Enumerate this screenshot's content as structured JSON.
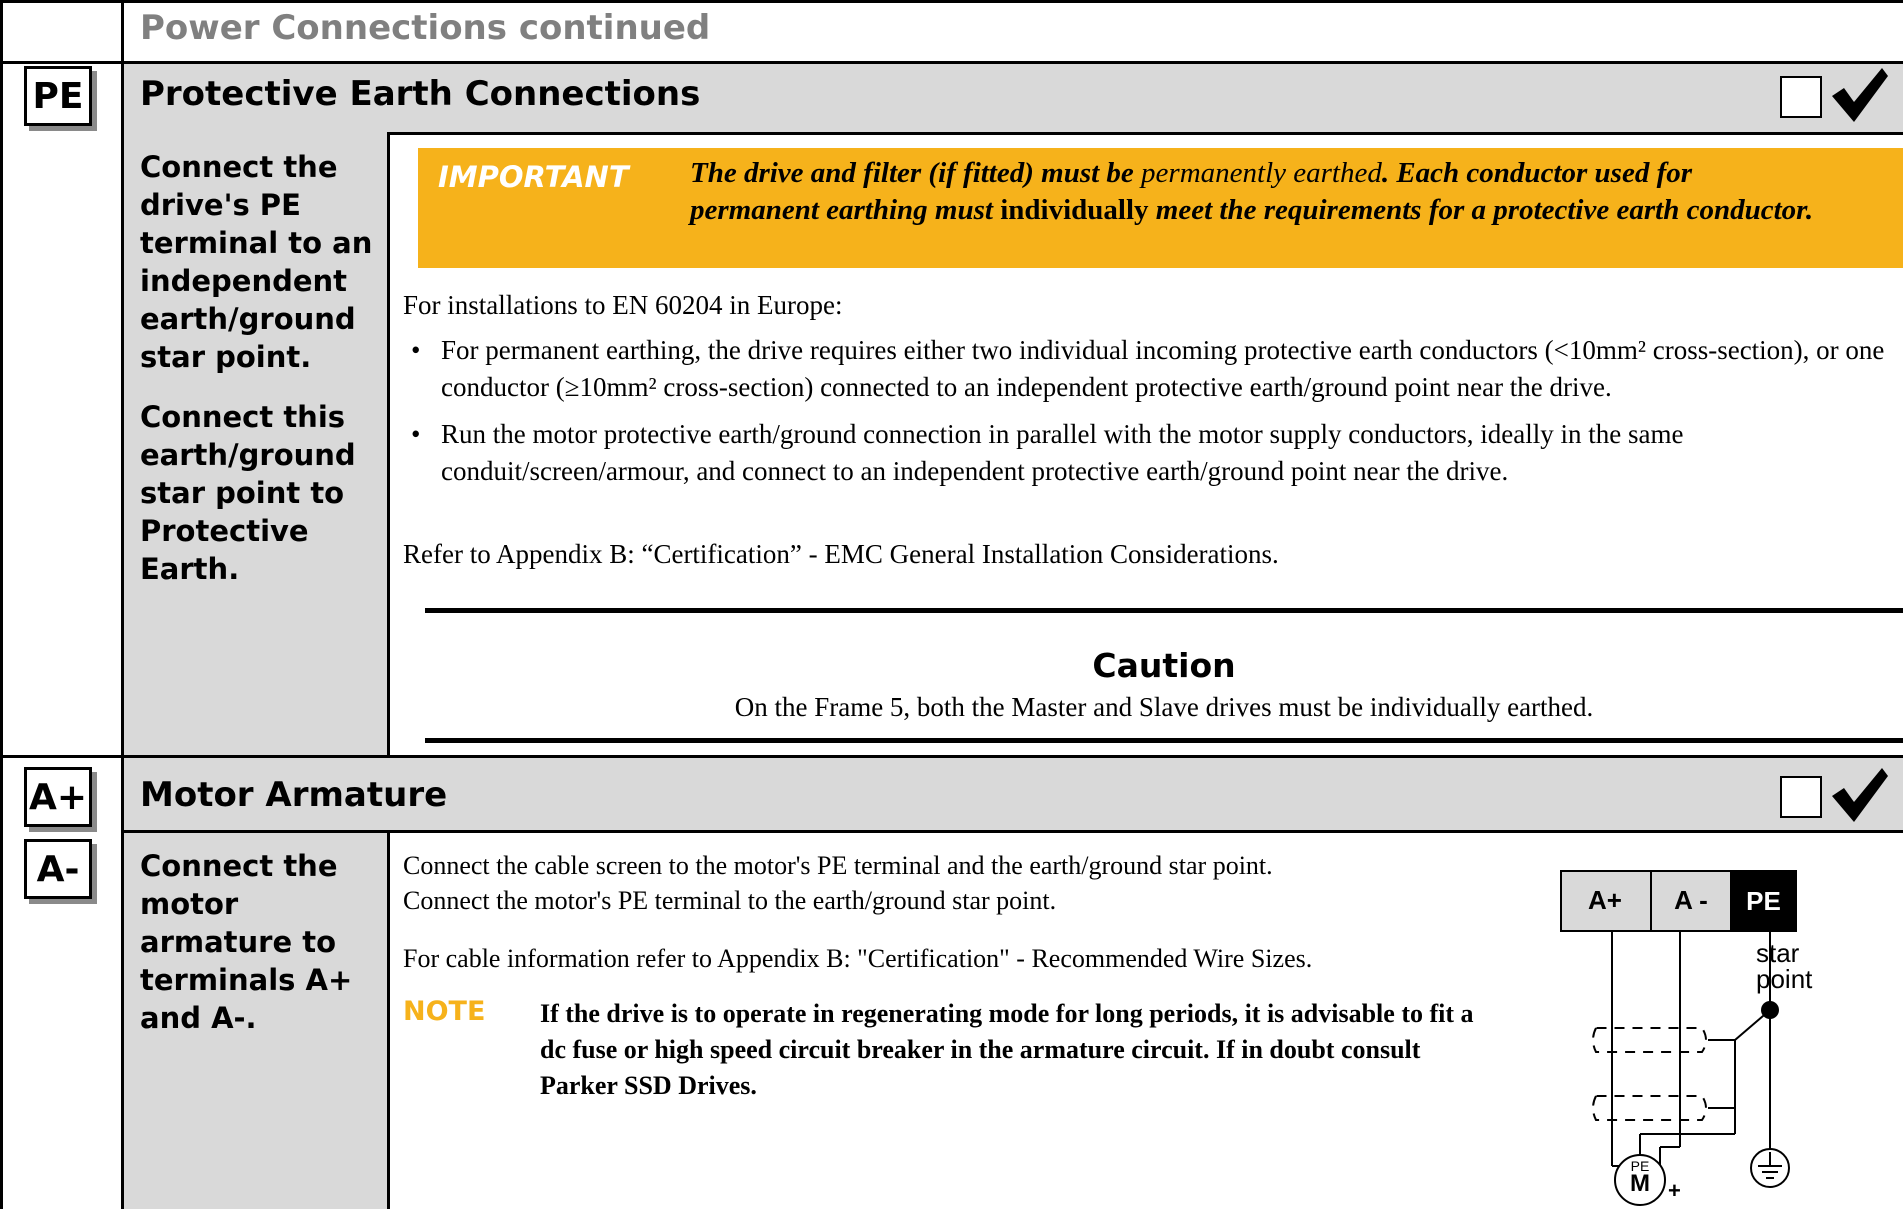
{
  "page_header": "Power Connections continued",
  "pe_section": {
    "tag": "PE",
    "title": "Protective Earth Connections",
    "instruction_1": "Connect the drive's PE terminal to an independent earth/ground star point.",
    "instruction_2": "Connect this earth/ground star point to Protective Earth.",
    "important_label": "IMPORTANT",
    "important_a": "The drive and filter (if fitted) must be ",
    "important_b": "permanently earthed",
    "important_c": ". Each conductor used for permanent earthing must ",
    "important_d": "individually",
    "important_e": " meet the requirements for a protective earth conductor.",
    "intro": "For installations to EN 60204 in Europe:",
    "bullets": [
      "For permanent earthing, the drive requires either two individual incoming protective earth conductors (<10mm² cross-section), or one conductor (≥10mm² cross-section) connected to an independent protective earth/ground point near the drive.",
      "Run the motor protective earth/ground connection in parallel with the motor supply conductors, ideally in the same conduit/screen/armour, and connect to an independent protective earth/ground point near the drive."
    ],
    "refer": "Refer to Appendix B: “Certification” - EMC General Installation Considerations.",
    "caution_title": "Caution",
    "caution_text": "On the Frame 5,  both the Master and Slave drives must be individually earthed."
  },
  "armature_section": {
    "tag_plus": "A+",
    "tag_minus": "A-",
    "title": "Motor Armature",
    "instruction": "Connect the motor armature to terminals A+ and A-.",
    "line1": "Connect the cable screen to the motor's PE terminal and the earth/ground star point.",
    "line2": "Connect the motor's PE terminal to the earth/ground star point.",
    "cable_info": "For cable information refer to Appendix B: \"Certification\" - Recommended Wire Sizes.",
    "note_label": "NOTE",
    "note_text": "If the drive is to operate in regenerating mode for long periods, it is advisable to fit a dc fuse or high speed circuit breaker in the armature circuit. If in doubt consult Parker SSD Drives."
  },
  "diagram": {
    "terminal_a_plus": "A+",
    "terminal_a_minus": "A -",
    "terminal_pe": "PE",
    "star_point_1": "star",
    "star_point_2": "point",
    "motor_pe": "PE",
    "motor_m": "M",
    "motor_plus": "+"
  }
}
